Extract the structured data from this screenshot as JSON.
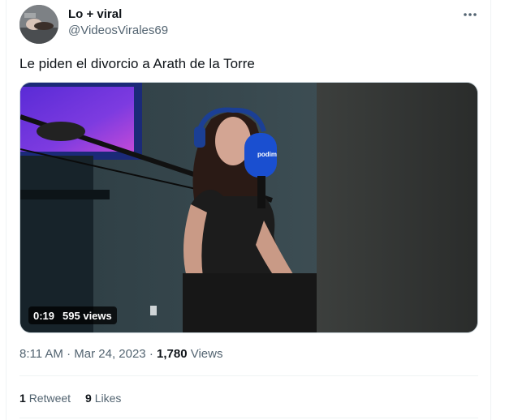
{
  "author": {
    "display_name": "Lo + viral",
    "handle": "@VideosVirales69"
  },
  "tweet": {
    "text": "Le piden el divorcio a Arath de la Torre"
  },
  "media": {
    "type": "video",
    "duration": "0:19",
    "views_label": "595 views",
    "mic_brand": "podim"
  },
  "meta": {
    "time": "8:11 AM",
    "separator": "·",
    "date": "Mar 24, 2023",
    "separator2": "·",
    "views_count": "1,780",
    "views_label": "Views"
  },
  "stats": {
    "retweets_count": "1",
    "retweets_label": "Retweet",
    "likes_count": "9",
    "likes_label": "Likes"
  },
  "icons": {
    "more": "more-options-icon",
    "avatar": "avatar-image"
  },
  "colors": {
    "text_primary": "#0f1419",
    "text_secondary": "#536471",
    "divider": "#eff3f4"
  }
}
